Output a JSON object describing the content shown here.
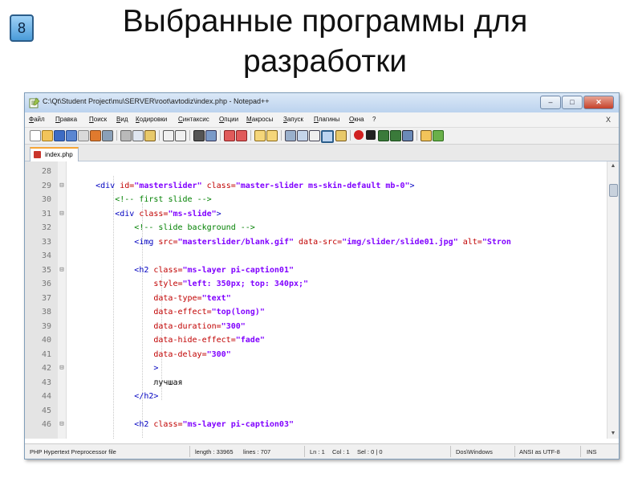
{
  "slide": {
    "number": "8",
    "title_line1": "Выбранные программы для",
    "title_line2": "разработки"
  },
  "window": {
    "title": "C:\\Qt\\Student Project\\mu\\SERVER\\root\\avtodiz\\index.php - Notepad++",
    "buttons": {
      "minimize": "–",
      "maximize": "□",
      "close": "✕"
    }
  },
  "menu": {
    "items": [
      "Файл",
      "Правка",
      "Поиск",
      "Вид",
      "Кодировки",
      "Синтаксис",
      "Опции",
      "Макросы",
      "Запуск",
      "Плагины",
      "Окна",
      "?"
    ],
    "close_x": "X"
  },
  "tab": {
    "label": "index.php",
    "icon": "php-file-icon"
  },
  "code": {
    "lines": [
      {
        "n": "28",
        "fold": "",
        "segs": []
      },
      {
        "n": "29",
        "fold": "⊟",
        "segs": [
          [
            "plain",
            "      "
          ],
          [
            "tag",
            "<div "
          ],
          [
            "attr",
            "id="
          ],
          [
            "str",
            "\"masterslider\""
          ],
          [
            "attr",
            " class="
          ],
          [
            "str",
            "\"master-slider ms-skin-default mb-0\""
          ],
          [
            "tag",
            ">"
          ]
        ]
      },
      {
        "n": "30",
        "fold": "",
        "segs": [
          [
            "plain",
            "          "
          ],
          [
            "cmt",
            "<!-- first slide -->"
          ]
        ]
      },
      {
        "n": "31",
        "fold": "⊟",
        "segs": [
          [
            "plain",
            "          "
          ],
          [
            "tag",
            "<div "
          ],
          [
            "attr",
            "class="
          ],
          [
            "str",
            "\"ms-slide\""
          ],
          [
            "tag",
            ">"
          ]
        ]
      },
      {
        "n": "32",
        "fold": "",
        "segs": [
          [
            "plain",
            "              "
          ],
          [
            "cmt",
            "<!-- slide background -->"
          ]
        ]
      },
      {
        "n": "33",
        "fold": "",
        "segs": [
          [
            "plain",
            "              "
          ],
          [
            "tag",
            "<img "
          ],
          [
            "attr",
            "src="
          ],
          [
            "str",
            "\"masterslider/blank.gif\""
          ],
          [
            "attr",
            " data-src="
          ],
          [
            "str",
            "\"img/slider/slide01.jpg\""
          ],
          [
            "attr",
            " alt="
          ],
          [
            "str",
            "\"Stron"
          ]
        ]
      },
      {
        "n": "34",
        "fold": "",
        "segs": []
      },
      {
        "n": "35",
        "fold": "⊟",
        "segs": [
          [
            "plain",
            "              "
          ],
          [
            "tag",
            "<h2 "
          ],
          [
            "attr",
            "class="
          ],
          [
            "str",
            "\"ms-layer pi-caption01\""
          ]
        ]
      },
      {
        "n": "36",
        "fold": "",
        "segs": [
          [
            "plain",
            "                  "
          ],
          [
            "attr",
            "style="
          ],
          [
            "str",
            "\"left: 350px; top: 340px;\""
          ]
        ]
      },
      {
        "n": "37",
        "fold": "",
        "segs": [
          [
            "plain",
            "                  "
          ],
          [
            "attr",
            "data-type="
          ],
          [
            "str",
            "\"text\""
          ]
        ]
      },
      {
        "n": "38",
        "fold": "",
        "segs": [
          [
            "plain",
            "                  "
          ],
          [
            "attr",
            "data-effect="
          ],
          [
            "str",
            "\"top(long)\""
          ]
        ]
      },
      {
        "n": "39",
        "fold": "",
        "segs": [
          [
            "plain",
            "                  "
          ],
          [
            "attr",
            "data-duration="
          ],
          [
            "str",
            "\"300\""
          ]
        ]
      },
      {
        "n": "40",
        "fold": "",
        "segs": [
          [
            "plain",
            "                  "
          ],
          [
            "attr",
            "data-hide-effect="
          ],
          [
            "str",
            "\"fade\""
          ]
        ]
      },
      {
        "n": "41",
        "fold": "",
        "segs": [
          [
            "plain",
            "                  "
          ],
          [
            "attr",
            "data-delay="
          ],
          [
            "str",
            "\"300\""
          ]
        ]
      },
      {
        "n": "42",
        "fold": "⊟",
        "segs": [
          [
            "plain",
            "                  "
          ],
          [
            "tag",
            ">"
          ]
        ]
      },
      {
        "n": "43",
        "fold": "",
        "segs": [
          [
            "plain",
            "                  "
          ],
          [
            "plain",
            "лучшая"
          ]
        ]
      },
      {
        "n": "44",
        "fold": "",
        "segs": [
          [
            "plain",
            "              "
          ],
          [
            "tag",
            "</h2>"
          ]
        ]
      },
      {
        "n": "45",
        "fold": "",
        "segs": []
      },
      {
        "n": "46",
        "fold": "⊟",
        "segs": [
          [
            "plain",
            "              "
          ],
          [
            "tag",
            "<h2 "
          ],
          [
            "attr",
            "class="
          ],
          [
            "str",
            "\"ms-layer pi-caption03\""
          ]
        ]
      }
    ]
  },
  "status": {
    "file_type": "PHP Hypertext Preprocessor file",
    "length": "length : 33965",
    "lines": "lines : 707",
    "ln": "Ln : 1",
    "col": "Col : 1",
    "sel": "Sel : 0 | 0",
    "eol": "Dos\\Windows",
    "encoding": "ANSI as UTF-8",
    "mode": "INS"
  },
  "colors": {
    "tag": "#0000c0",
    "attribute": "#c00000",
    "string": "#8000ff",
    "comment": "#008000",
    "gutter": "#e4e4e4",
    "titlebar": "#bcd3ee"
  }
}
